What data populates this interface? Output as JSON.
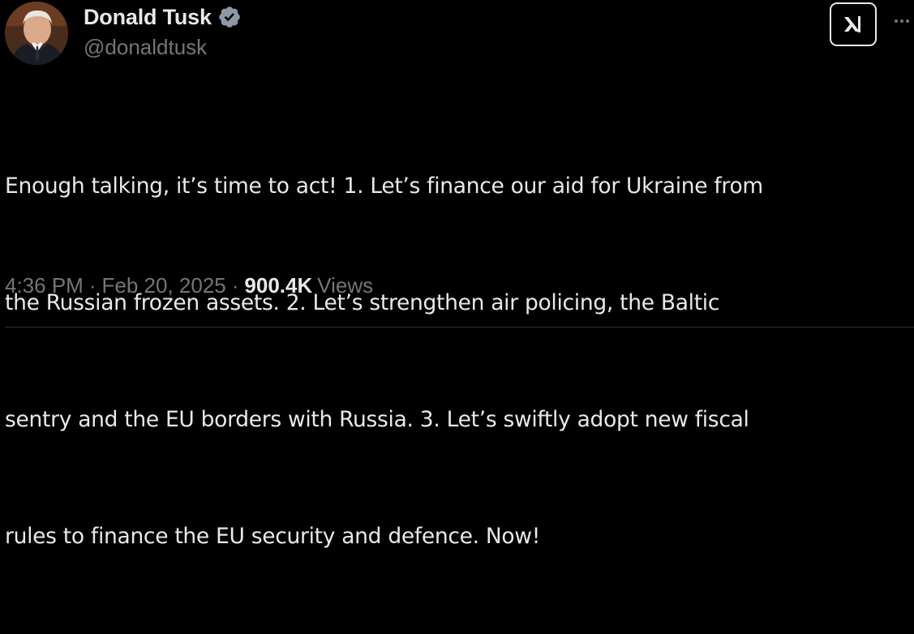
{
  "author": {
    "display_name": "Donald Tusk",
    "handle": "@donaldtusk",
    "verified": true,
    "verified_color": "#8b98a5"
  },
  "tweet": {
    "text_lines": [
      "Enough talking, it’s time to act! 1. Let’s finance our aid for Ukraine from",
      "the Russian frozen assets. 2. Let’s strengthen air policing, the Baltic",
      "sentry and the EU borders with Russia. 3. Let’s swiftly adopt new fiscal",
      "rules to finance the EU security and defence. Now!"
    ]
  },
  "meta": {
    "time": "4:36 PM",
    "separator": "·",
    "date": "Feb 20, 2025",
    "views_count": "900.4K",
    "views_label": "Views"
  },
  "icons": {
    "verified": "verified-badge-icon",
    "grok": "grok-icon",
    "more": "more-dots-icon"
  },
  "colors": {
    "background": "#000000",
    "primary_text": "#e7e9ea",
    "secondary_text": "#71767b",
    "divider": "#2f3336"
  }
}
